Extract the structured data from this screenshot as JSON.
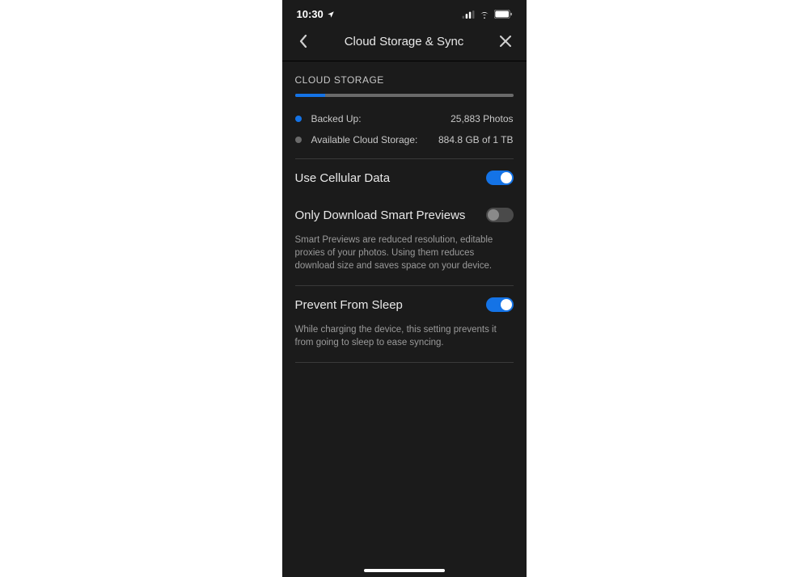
{
  "status_bar": {
    "time": "10:30"
  },
  "nav": {
    "title": "Cloud Storage & Sync"
  },
  "storage": {
    "section_title": "CLOUD STORAGE",
    "progress_percent": 14,
    "backed_up_label": "Backed Up:",
    "backed_up_value": "25,883 Photos",
    "available_label": "Available Cloud Storage:",
    "available_value": "884.8 GB of 1 TB"
  },
  "settings": {
    "cellular": {
      "label": "Use Cellular Data",
      "enabled": true
    },
    "smart_previews": {
      "label": "Only Download Smart Previews",
      "enabled": false,
      "description": "Smart Previews are reduced resolution, editable proxies of your photos. Using them reduces download size and saves space on your device."
    },
    "prevent_sleep": {
      "label": "Prevent From Sleep",
      "enabled": true,
      "description": "While charging the device, this setting prevents it from going to sleep to ease syncing."
    }
  }
}
